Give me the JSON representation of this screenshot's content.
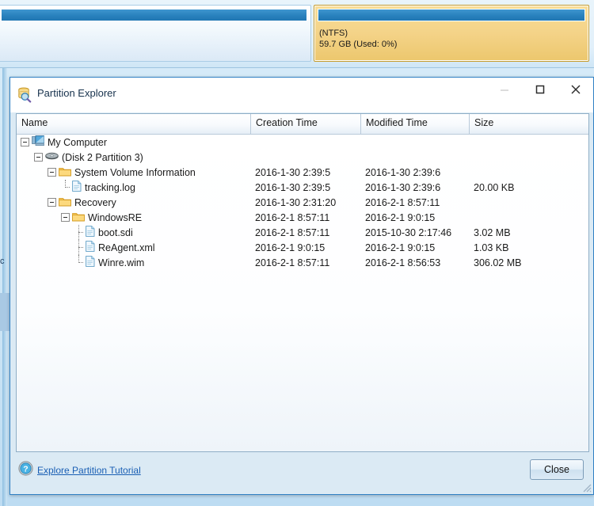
{
  "background": {
    "partitions": [
      {
        "name": "partition-unselected",
        "fs": "",
        "info": "",
        "selected": false
      },
      {
        "name": "partition-selected",
        "fs": "(NTFS)",
        "info": "59.7 GB (Used: 0%)",
        "selected": true
      }
    ],
    "stray_text": "c"
  },
  "dialog": {
    "title": "Partition Explorer",
    "icon": "partition-explorer-icon",
    "window_controls": {
      "minimize": "minimize-icon",
      "maximize": "maximize-icon",
      "close": "close-icon"
    },
    "columns": [
      {
        "key": "name",
        "label": "Name"
      },
      {
        "key": "created",
        "label": "Creation Time"
      },
      {
        "key": "modified",
        "label": "Modified Time"
      },
      {
        "key": "size",
        "label": "Size"
      }
    ],
    "rows": [
      {
        "label": "My Computer",
        "icon": "computer-icon",
        "depth": 0,
        "expanded": true,
        "created": "",
        "modified": "",
        "size": ""
      },
      {
        "label": "(Disk 2 Partition 3)",
        "icon": "disk-icon",
        "depth": 1,
        "expanded": true,
        "created": "",
        "modified": "",
        "size": ""
      },
      {
        "label": "System Volume Information",
        "icon": "folder-icon",
        "depth": 2,
        "expanded": true,
        "created": "2016-1-30 2:39:5",
        "modified": "2016-1-30 2:39:6",
        "size": ""
      },
      {
        "label": "tracking.log",
        "icon": "file-icon",
        "depth": 3,
        "expanded": false,
        "last": true,
        "created": "2016-1-30 2:39:5",
        "modified": "2016-1-30 2:39:6",
        "size": "20.00 KB"
      },
      {
        "label": "Recovery",
        "icon": "folder-icon",
        "depth": 2,
        "expanded": true,
        "created": "2016-1-30 2:31:20",
        "modified": "2016-2-1 8:57:11",
        "size": ""
      },
      {
        "label": "WindowsRE",
        "icon": "folder-icon",
        "depth": 3,
        "expanded": true,
        "created": "2016-2-1 8:57:11",
        "modified": "2016-2-1 9:0:15",
        "size": ""
      },
      {
        "label": "boot.sdi",
        "icon": "file-icon",
        "depth": 4,
        "expanded": false,
        "created": "2016-2-1 8:57:11",
        "modified": "2015-10-30 2:17:46",
        "size": "3.02 MB"
      },
      {
        "label": "ReAgent.xml",
        "icon": "file-icon",
        "depth": 4,
        "expanded": false,
        "created": "2016-2-1 9:0:15",
        "modified": "2016-2-1 9:0:15",
        "size": "1.03 KB"
      },
      {
        "label": "Winre.wim",
        "icon": "file-icon",
        "depth": 4,
        "expanded": false,
        "last": true,
        "created": "2016-2-1 8:57:11",
        "modified": "2016-2-1 8:56:53",
        "size": "306.02 MB"
      }
    ],
    "footer": {
      "help_icon": "help-icon",
      "tutorial_link": "Explore Partition Tutorial",
      "close_label": "Close"
    }
  },
  "colors": {
    "accent_blue": "#2f80c4",
    "selected_partition": "#f4d388",
    "bar_blue": "#2a83bf",
    "link": "#1a5fb4",
    "dialog_bg": "#dbeaf4"
  }
}
